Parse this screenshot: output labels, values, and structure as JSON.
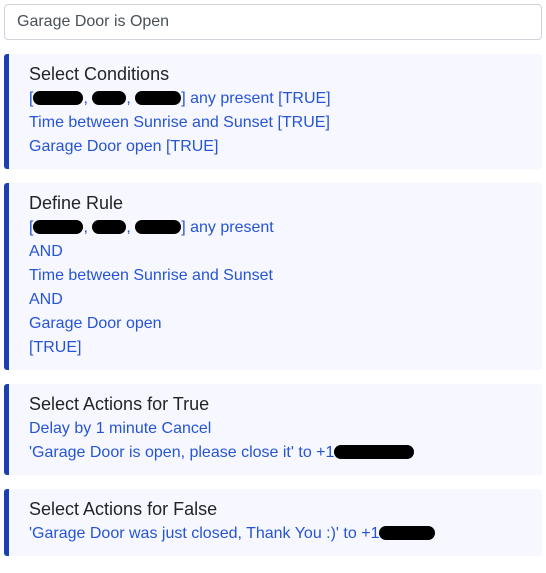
{
  "rule_name": "Garage Door is Open",
  "sections": {
    "conditions": {
      "title": "Select Conditions",
      "lines": {
        "presence_prefix": "[",
        "presence_mid1": ", ",
        "presence_mid2": ", ",
        "presence_suffix": "] any present [TRUE]",
        "time": "Time between Sunrise and Sunset [TRUE]",
        "door": "Garage Door open [TRUE]"
      }
    },
    "rule": {
      "title": "Define Rule",
      "lines": {
        "presence_prefix": "[",
        "presence_mid1": ", ",
        "presence_mid2": ", ",
        "presence_suffix": "] any present",
        "and1": "AND",
        "time": "Time between Sunrise and Sunset",
        "and2": "AND",
        "door": "Garage Door open",
        "result": "[TRUE]"
      }
    },
    "true_actions": {
      "title": "Select Actions for True",
      "lines": {
        "delay": "Delay by 1 minute Cancel",
        "msg_prefix": " 'Garage Door is open, please close it' to +1"
      }
    },
    "false_actions": {
      "title": "Select Actions for False",
      "lines": {
        "msg_prefix": " 'Garage Door was just closed, Thank You :)' to +1"
      }
    }
  }
}
